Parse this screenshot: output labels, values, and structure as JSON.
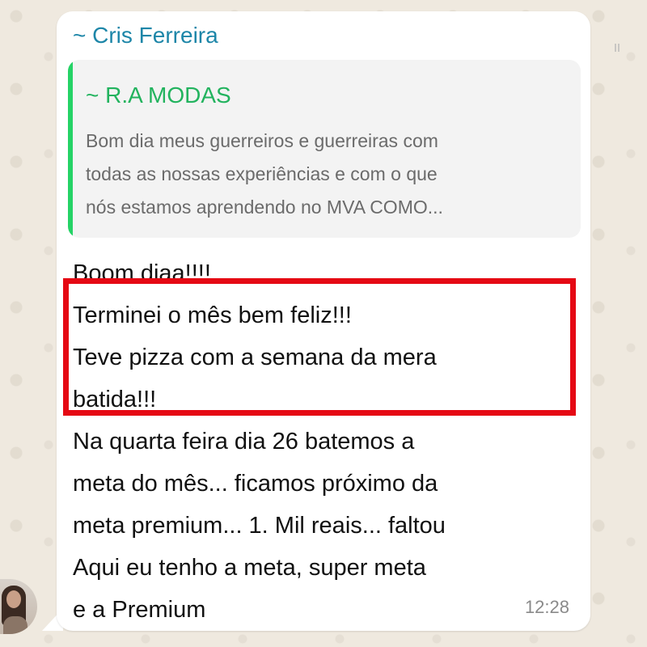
{
  "chat": {
    "sender_name": "~ Cris Ferreira",
    "time": "12:28",
    "quoted": {
      "name": "~ R.A MODAS",
      "text": "Bom dia meus guerreiros e guerreiras com\ntodas as nossas experiências e com o que\nnós estamos aprendendo no MVA COMO..."
    },
    "message": "Boom diaa!!!!\nTerminei o mês bem feliz!!!\nTeve pizza com a semana da mera\nbatida!!!\nNa quarta feira dia 26 batemos a\nmeta do mês... ficamos próximo da\nmeta premium... 1. Mil reais... faltou\nAqui eu tenho a meta, super meta\ne a Premium"
  },
  "colors": {
    "highlight": "#e50914",
    "sender": "#1d86a8",
    "quoted_sender": "#22b35e",
    "quote_bar": "#25d366"
  },
  "icons": {
    "avatar": "user-avatar"
  }
}
